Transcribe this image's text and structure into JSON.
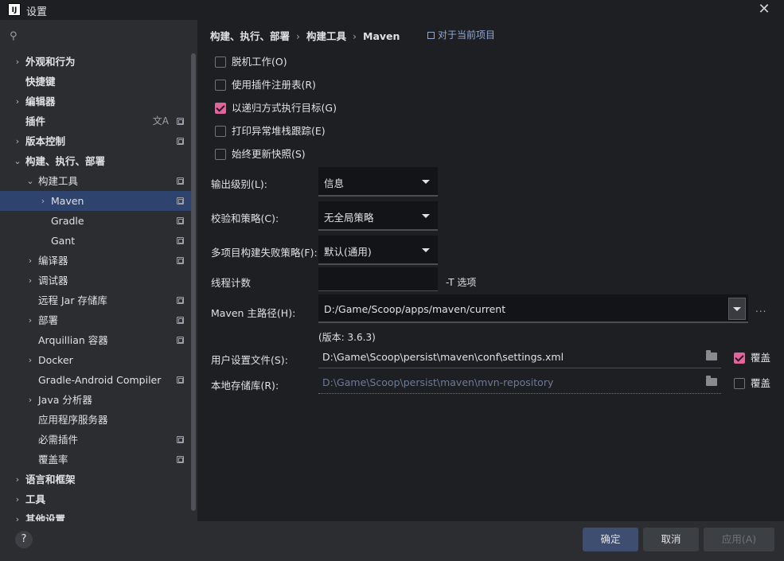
{
  "window": {
    "title": "设置",
    "app_icon_text": "IJ"
  },
  "search": {
    "placeholder": ""
  },
  "sidebar": {
    "items": [
      {
        "label": "外观和行为",
        "chevron": "›"
      },
      {
        "label": "快捷键",
        "chevron": ""
      },
      {
        "label": "编辑器",
        "chevron": "›"
      },
      {
        "label": "插件",
        "chevron": ""
      },
      {
        "label": "版本控制",
        "chevron": "›"
      },
      {
        "label": "构建、执行、部署",
        "chevron": "⌄"
      },
      {
        "label": "构建工具",
        "chevron": "⌄"
      },
      {
        "label": "Maven",
        "chevron": "›"
      },
      {
        "label": "Gradle",
        "chevron": ""
      },
      {
        "label": "Gant",
        "chevron": ""
      },
      {
        "label": "编译器",
        "chevron": "›"
      },
      {
        "label": "调试器",
        "chevron": "›"
      },
      {
        "label": "远程 Jar 存储库",
        "chevron": ""
      },
      {
        "label": "部署",
        "chevron": "›"
      },
      {
        "label": "Arquillian 容器",
        "chevron": ""
      },
      {
        "label": "Docker",
        "chevron": "›"
      },
      {
        "label": "Gradle-Android Compiler",
        "chevron": ""
      },
      {
        "label": "Java 分析器",
        "chevron": "›"
      },
      {
        "label": "应用程序服务器",
        "chevron": ""
      },
      {
        "label": "必需插件",
        "chevron": ""
      },
      {
        "label": "覆盖率",
        "chevron": ""
      },
      {
        "label": "语言和框架",
        "chevron": "›"
      },
      {
        "label": "工具",
        "chevron": "›"
      },
      {
        "label": "其他设置",
        "chevron": "›"
      }
    ]
  },
  "breadcrumb": {
    "part1": "构建、执行、部署",
    "part2": "构建工具",
    "part3": "Maven",
    "sep": "›"
  },
  "scope_label": "对于当前项目",
  "options": {
    "offline": {
      "label": "脱机工作(O)",
      "checked": false
    },
    "plugin_registry": {
      "label": "使用插件注册表(R)",
      "checked": false
    },
    "recursive": {
      "label": "以递归方式执行目标(G)",
      "checked": true
    },
    "stack_trace": {
      "label": "打印异常堆栈跟踪(E)",
      "checked": false
    },
    "update_snapshots": {
      "label": "始终更新快照(S)",
      "checked": false
    }
  },
  "fields": {
    "output_level": {
      "label": "输出级别(L):",
      "value": "信息"
    },
    "checksum": {
      "label": "校验和策略(C):",
      "value": "无全局策略"
    },
    "fail_policy": {
      "label": "多项目构建失败策略(F):",
      "value": "默认(通用)"
    },
    "thread_count": {
      "label": "线程计数",
      "value": "",
      "hint": "-T 选项"
    },
    "maven_home": {
      "label": "Maven 主路径(H):",
      "value": "D:/Game/Scoop/apps/maven/current",
      "more": "..."
    },
    "version": "(版本: 3.6.3)",
    "user_settings": {
      "label": "用户设置文件(S):",
      "value": "D:\\Game\\Scoop\\persist\\maven\\conf\\settings.xml",
      "override_label": "覆盖",
      "override": true
    },
    "local_repo": {
      "label": "本地存储库(R):",
      "value": "D:\\Game\\Scoop\\persist\\maven\\mvn-repository",
      "override_label": "覆盖",
      "override": false
    }
  },
  "footer": {
    "help": "?",
    "ok": "确定",
    "cancel": "取消",
    "apply": "应用(A)"
  },
  "colors": {
    "accent": "#e0659c",
    "selection": "#2e436e",
    "link": "#8fa9d8"
  }
}
